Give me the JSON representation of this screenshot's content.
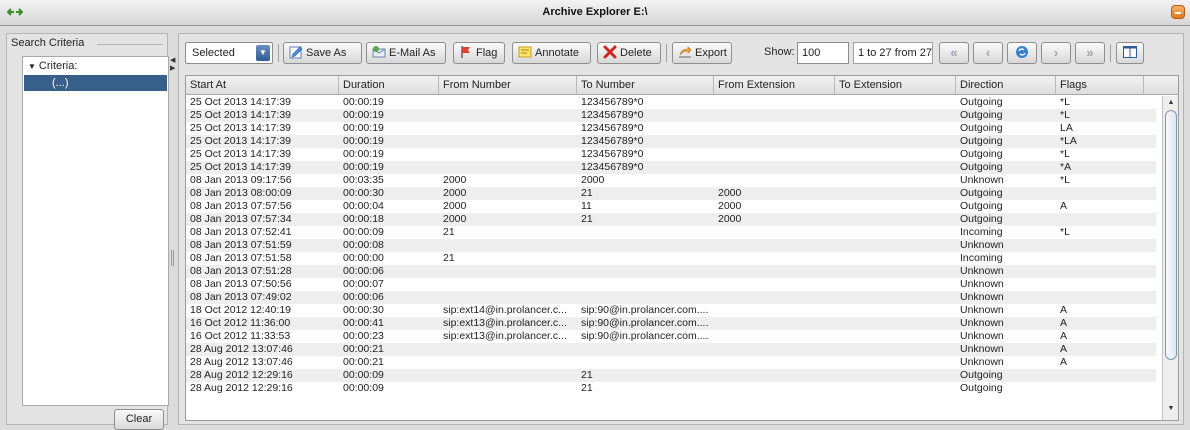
{
  "window": {
    "title": "Archive Explorer E:\\"
  },
  "left": {
    "legend": "Search Criteria",
    "tree_root": "Criteria:",
    "tree_child": "(...)",
    "clear_label": "Clear"
  },
  "toolbar": {
    "select_value": "Selected",
    "save_as": "Save As",
    "email_as": "E-Mail As",
    "flag": "Flag",
    "annotate": "Annotate",
    "delete": "Delete",
    "export": "Export",
    "show_label": "Show:",
    "show_value": "100",
    "range": "1 to 27 from 27"
  },
  "table": {
    "headers": [
      "Start At",
      "Duration",
      "From Number",
      "To Number",
      "From Extension",
      "To Extension",
      "Direction",
      "Flags"
    ],
    "rows": [
      [
        "25 Oct 2013 14:17:39",
        "00:00:19",
        "",
        "123456789*0",
        "",
        "",
        "Outgoing",
        "*L"
      ],
      [
        "25 Oct 2013 14:17:39",
        "00:00:19",
        "",
        "123456789*0",
        "",
        "",
        "Outgoing",
        "*L"
      ],
      [
        "25 Oct 2013 14:17:39",
        "00:00:19",
        "",
        "123456789*0",
        "",
        "",
        "Outgoing",
        "LA"
      ],
      [
        "25 Oct 2013 14:17:39",
        "00:00:19",
        "",
        "123456789*0",
        "",
        "",
        "Outgoing",
        "*LA"
      ],
      [
        "25 Oct 2013 14:17:39",
        "00:00:19",
        "",
        "123456789*0",
        "",
        "",
        "Outgoing",
        "*L"
      ],
      [
        "25 Oct 2013 14:17:39",
        "00:00:19",
        "",
        "123456789*0",
        "",
        "",
        "Outgoing",
        "*A"
      ],
      [
        "08 Jan 2013 09:17:56",
        "00:03:35",
        "2000",
        "2000",
        "",
        "",
        "Unknown",
        "*L"
      ],
      [
        "08 Jan 2013 08:00:09",
        "00:00:30",
        "2000",
        "21",
        "2000",
        "",
        "Outgoing",
        ""
      ],
      [
        "08 Jan 2013 07:57:56",
        "00:00:04",
        "2000",
        "11",
        "2000",
        "",
        "Outgoing",
        "A"
      ],
      [
        "08 Jan 2013 07:57:34",
        "00:00:18",
        "2000",
        "21",
        "2000",
        "",
        "Outgoing",
        ""
      ],
      [
        "08 Jan 2013 07:52:41",
        "00:00:09",
        "21",
        "",
        "",
        "",
        "Incoming",
        "*L"
      ],
      [
        "08 Jan 2013 07:51:59",
        "00:00:08",
        "",
        "",
        "",
        "",
        "Unknown",
        ""
      ],
      [
        "08 Jan 2013 07:51:58",
        "00:00:00",
        "21",
        "",
        "",
        "",
        "Incoming",
        ""
      ],
      [
        "08 Jan 2013 07:51:28",
        "00:00:06",
        "",
        "",
        "",
        "",
        "Unknown",
        ""
      ],
      [
        "08 Jan 2013 07:50:56",
        "00:00:07",
        "",
        "",
        "",
        "",
        "Unknown",
        ""
      ],
      [
        "08 Jan 2013 07:49:02",
        "00:00:06",
        "",
        "",
        "",
        "",
        "Unknown",
        ""
      ],
      [
        "18 Oct 2012 12:40:19",
        "00:00:30",
        "sip:ext14@in.prolancer.c...",
        "sip:90@in.prolancer.com....",
        "",
        "",
        "Unknown",
        "A"
      ],
      [
        "16 Oct 2012 11:36:00",
        "00:00:41",
        "sip:ext13@in.prolancer.c...",
        "sip:90@in.prolancer.com....",
        "",
        "",
        "Unknown",
        "A"
      ],
      [
        "16 Oct 2012 11:33:53",
        "00:00:23",
        "sip:ext13@in.prolancer.c...",
        "sip:90@in.prolancer.com....",
        "",
        "",
        "Unknown",
        "A"
      ],
      [
        "28 Aug 2012 13:07:46",
        "00:00:21",
        "",
        "",
        "",
        "",
        "Unknown",
        "A"
      ],
      [
        "28 Aug 2012 13:07:46",
        "00:00:21",
        "",
        "",
        "",
        "",
        "Unknown",
        "A"
      ],
      [
        "28 Aug 2012 12:29:16",
        "00:00:09",
        "",
        "21",
        "",
        "",
        "Outgoing",
        ""
      ],
      [
        "28 Aug 2012 12:29:16",
        "00:00:09",
        "",
        "21",
        "",
        "",
        "Outgoing",
        ""
      ]
    ]
  }
}
